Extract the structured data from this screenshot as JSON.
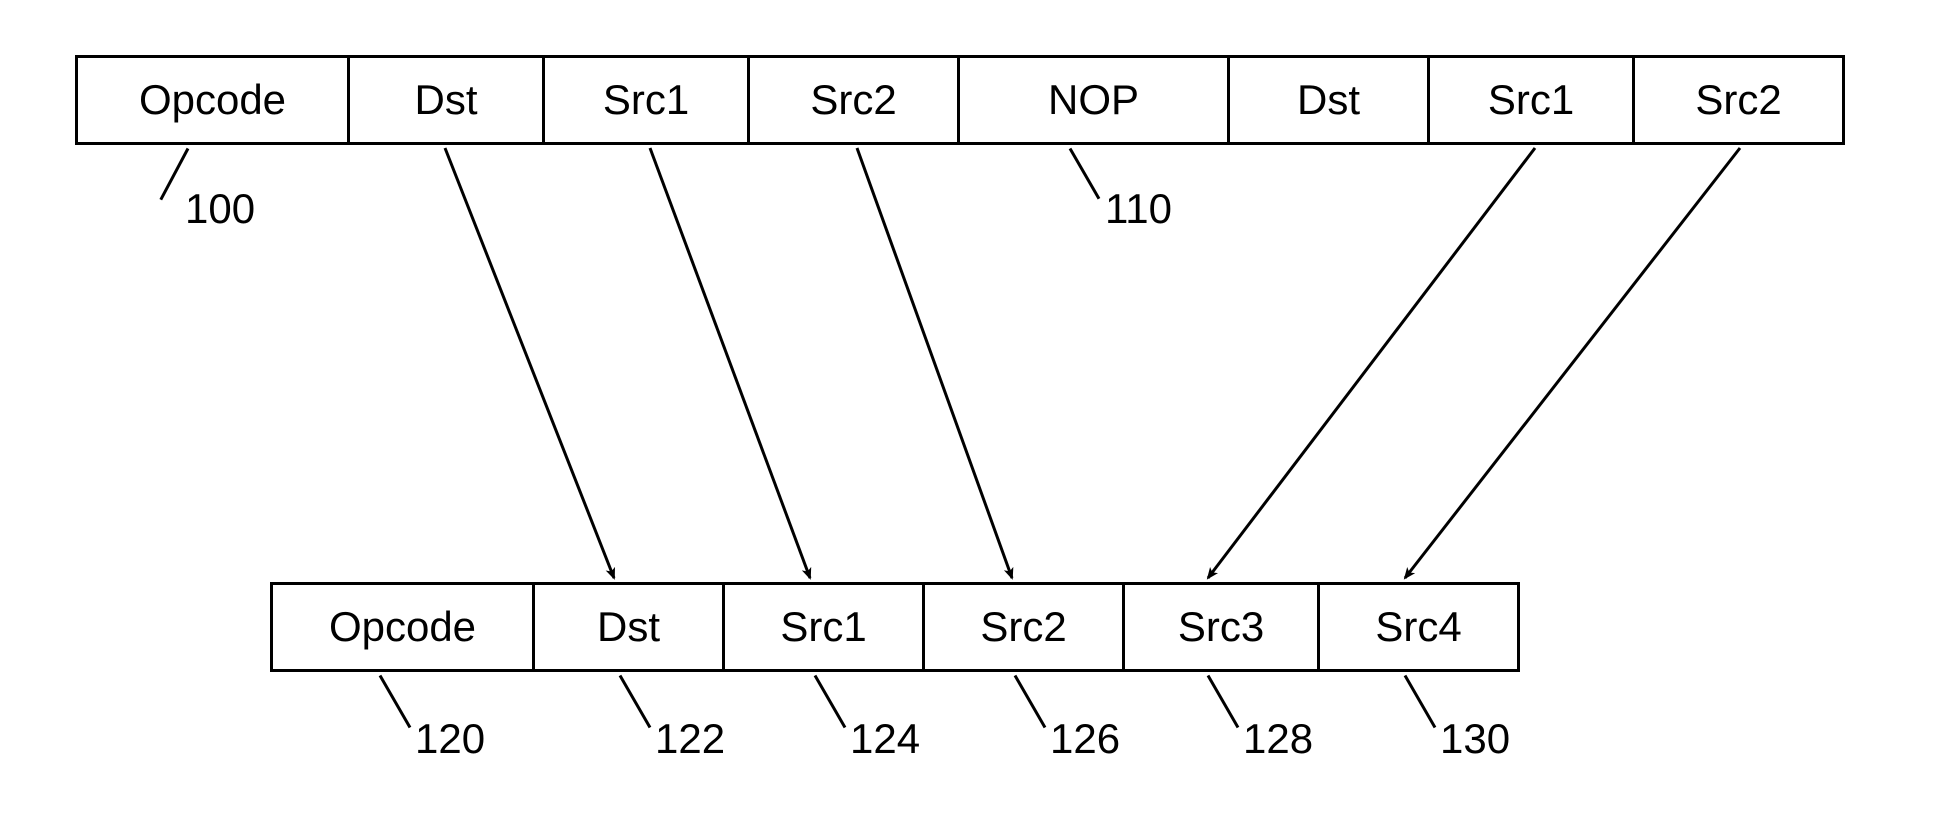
{
  "top_row": {
    "cells": [
      {
        "label": "Opcode",
        "ref": "100"
      },
      {
        "label": "Dst",
        "ref": null
      },
      {
        "label": "Src1",
        "ref": null
      },
      {
        "label": "Src2",
        "ref": null
      },
      {
        "label": "NOP",
        "ref": "110"
      },
      {
        "label": "Dst",
        "ref": null
      },
      {
        "label": "Src1",
        "ref": null
      },
      {
        "label": "Src2",
        "ref": null
      }
    ]
  },
  "bottom_row": {
    "cells": [
      {
        "label": "Opcode",
        "ref": "120"
      },
      {
        "label": "Dst",
        "ref": "122"
      },
      {
        "label": "Src1",
        "ref": "124"
      },
      {
        "label": "Src2",
        "ref": "126"
      },
      {
        "label": "Src3",
        "ref": "128"
      },
      {
        "label": "Src4",
        "ref": "130"
      }
    ]
  },
  "arrows_description": "Five arrows: top Dst→bottom Dst, top Src1→bottom Src1, top Src2→bottom Src2, top(second) Src1→bottom Src3, top(second) Src2→bottom Src4"
}
